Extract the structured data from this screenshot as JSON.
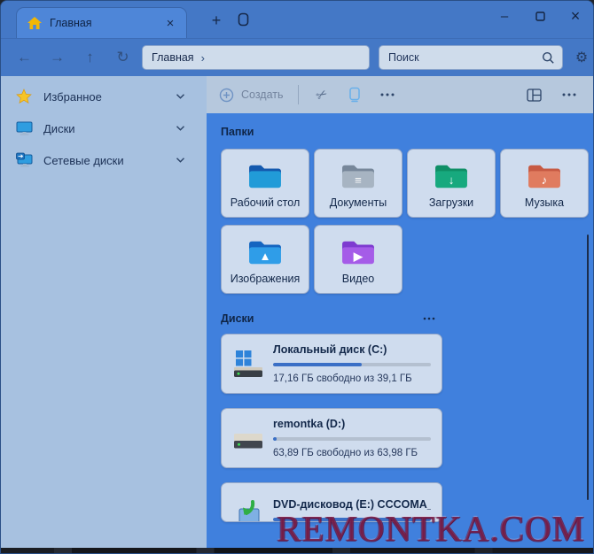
{
  "window": {
    "tab_title": "Главная",
    "controls": {
      "minimize": "–",
      "maximize": "",
      "close": "×"
    }
  },
  "navbar": {
    "address": "Главная",
    "address_separator": "›",
    "search_placeholder": "Поиск"
  },
  "command_bar": {
    "new_label": "Создать"
  },
  "sidebar": {
    "items": [
      {
        "label": "Избранное",
        "icon": "star"
      },
      {
        "label": "Диски",
        "icon": "drives"
      },
      {
        "label": "Сетевые диски",
        "icon": "network"
      }
    ]
  },
  "main": {
    "folders_header": "Папки",
    "folders": [
      {
        "name": "Рабочий стол",
        "glyph": "",
        "vars": {
          "--back": "#1459ae",
          "--front": "#219bd8"
        }
      },
      {
        "name": "Документы",
        "glyph": "≡",
        "vars": {
          "--back": "#77879a",
          "--front": "#a7b4c2"
        }
      },
      {
        "name": "Загрузки",
        "glyph": "↓",
        "vars": {
          "--back": "#0f8f66",
          "--front": "#17a97e"
        }
      },
      {
        "name": "Музыка",
        "glyph": "♪",
        "vars": {
          "--back": "#c75a43",
          "--front": "#e07b5f"
        }
      },
      {
        "name": "Изображения",
        "glyph": "▲",
        "vars": {
          "--back": "#1565c0",
          "--front": "#2f9de8"
        }
      },
      {
        "name": "Видео",
        "glyph": "▶",
        "vars": {
          "--back": "#7e3bd0",
          "--front": "#a55ce8"
        }
      }
    ],
    "drives_header": "Диски",
    "drives": [
      {
        "name": "Локальный диск (C:)",
        "free": "17,16 ГБ свободно из 39,1 ГБ",
        "percent": 56,
        "icon": "win"
      },
      {
        "name": "remontka (D:)",
        "free": "63,89 ГБ свободно из 63,98 ГБ",
        "percent": 2,
        "icon": "hdd"
      },
      {
        "name": "DVD-дисковод (E:) CCCOMA_...",
        "percent": 100,
        "icon": "dvd",
        "clipped": true
      }
    ]
  },
  "watermark": "REMONTKA.COM",
  "colors": {
    "titlebar": "#4478c6",
    "active_tab": "#4e86d8",
    "sidebar": "#a7c1e0",
    "command_bar": "#b6c8dd",
    "content": "#4080dd",
    "tile": "#cfdcee",
    "meter_fill": "#3a6fc6",
    "watermark": "#96325f"
  }
}
